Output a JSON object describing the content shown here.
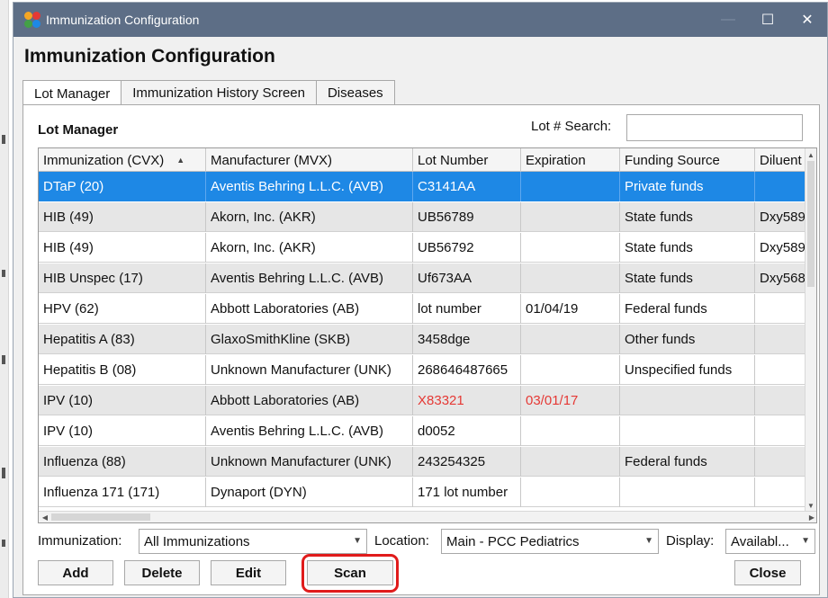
{
  "window": {
    "title": "Immunization Configuration",
    "controls": {
      "minimize": "—",
      "maximize": "☐",
      "close": "✕"
    }
  },
  "heading": "Immunization Configuration",
  "tabs": [
    {
      "label": "Lot Manager",
      "active": true
    },
    {
      "label": "Immunization History Screen",
      "active": false
    },
    {
      "label": "Diseases",
      "active": false
    }
  ],
  "lot_manager": {
    "title": "Lot Manager",
    "search_label": "Lot # Search:",
    "search_value": ""
  },
  "table": {
    "columns": [
      "Immunization (CVX)",
      "Manufacturer (MVX)",
      "Lot Number",
      "Expiration",
      "Funding Source",
      "Diluent"
    ],
    "sort_indicator": "▲",
    "rows": [
      {
        "cvx": "DTaP (20)",
        "mvx": "Aventis Behring L.L.C. (AVB)",
        "lot": "C3141AA",
        "exp": "",
        "funding": "Private funds",
        "diluent": ""
      },
      {
        "cvx": "HIB (49)",
        "mvx": "Akorn, Inc. (AKR)",
        "lot": "UB56789",
        "exp": "",
        "funding": "State funds",
        "diluent": "Dxy589"
      },
      {
        "cvx": "HIB (49)",
        "mvx": "Akorn, Inc. (AKR)",
        "lot": "UB56792",
        "exp": "",
        "funding": "State funds",
        "diluent": "Dxy589"
      },
      {
        "cvx": "HIB Unspec (17)",
        "mvx": "Aventis Behring L.L.C. (AVB)",
        "lot": "Uf673AA",
        "exp": "",
        "funding": "State funds",
        "diluent": "Dxy568"
      },
      {
        "cvx": "HPV (62)",
        "mvx": "Abbott Laboratories (AB)",
        "lot": "lot number",
        "exp": "01/04/19",
        "funding": "Federal funds",
        "diluent": ""
      },
      {
        "cvx": "Hepatitis A (83)",
        "mvx": "GlaxoSmithKline (SKB)",
        "lot": "3458dge",
        "exp": "",
        "funding": "Other funds",
        "diluent": ""
      },
      {
        "cvx": "Hepatitis B (08)",
        "mvx": "Unknown Manufacturer (UNK)",
        "lot": "268646487665",
        "exp": "",
        "funding": "Unspecified funds",
        "diluent": ""
      },
      {
        "cvx": "IPV (10)",
        "mvx": "Abbott Laboratories (AB)",
        "lot": "X83321",
        "exp": "03/01/17",
        "funding": "",
        "diluent": ""
      },
      {
        "cvx": "IPV (10)",
        "mvx": "Aventis Behring L.L.C. (AVB)",
        "lot": "d0052",
        "exp": "",
        "funding": "",
        "diluent": ""
      },
      {
        "cvx": "Influenza (88)",
        "mvx": "Unknown Manufacturer (UNK)",
        "lot": "243254325",
        "exp": "",
        "funding": "Federal funds",
        "diluent": ""
      },
      {
        "cvx": "Influenza 171 (171)",
        "mvx": "Dynaport (DYN)",
        "lot": "171 lot number",
        "exp": "",
        "funding": "",
        "diluent": ""
      }
    ]
  },
  "filters": {
    "immunization_label": "Immunization:",
    "immunization_value": "All Immunizations",
    "location_label": "Location:",
    "location_value": "Main - PCC Pediatrics",
    "display_label": "Display:",
    "display_value": "Availabl..."
  },
  "buttons": {
    "add": "Add",
    "delete": "Delete",
    "edit": "Edit",
    "scan": "Scan",
    "close": "Close"
  },
  "colors": {
    "titlebar": "#5d6e86",
    "selection": "#1e88e5",
    "expired": "#e53935",
    "highlight": "#e01b1b"
  }
}
